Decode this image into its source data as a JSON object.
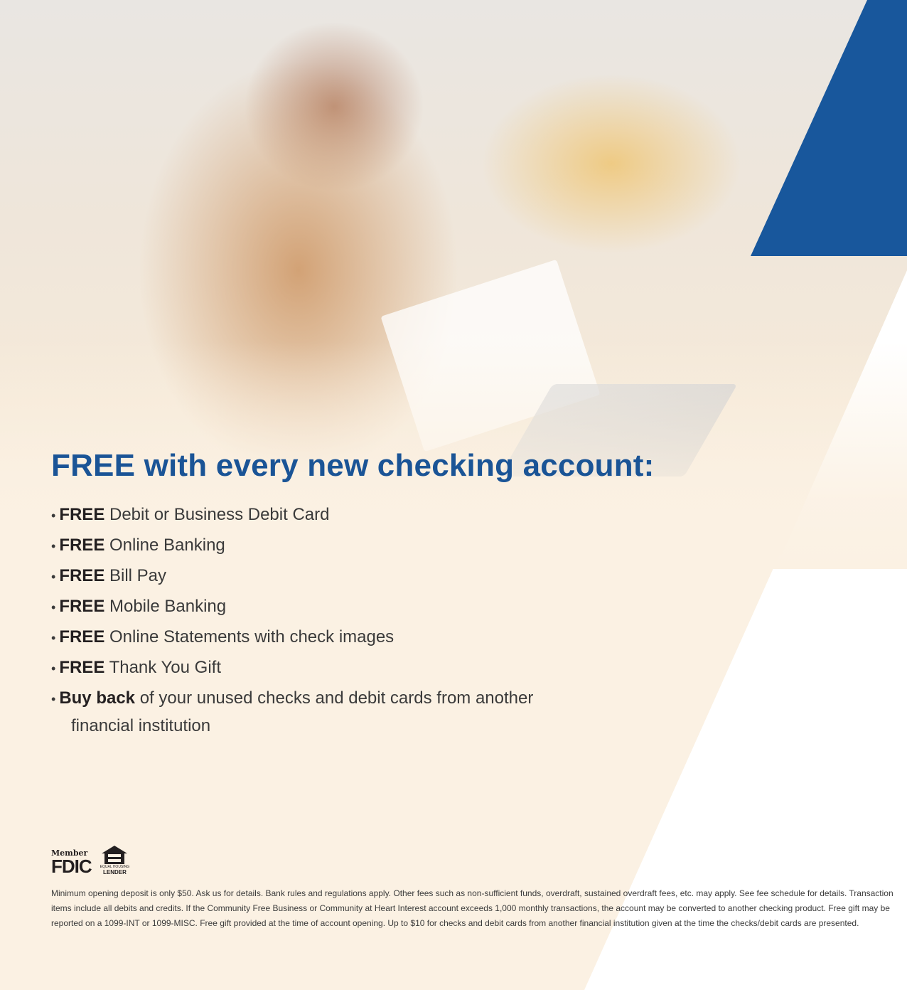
{
  "headline": "FREE with every new checking account:",
  "features": [
    {
      "bold": "FREE",
      "text": " Debit or Business Debit Card"
    },
    {
      "bold": "FREE",
      "text": " Online Banking"
    },
    {
      "bold": "FREE",
      "text": " Bill Pay"
    },
    {
      "bold": "FREE",
      "text": " Mobile Banking"
    },
    {
      "bold": "FREE",
      "text": " Online Statements with check images"
    },
    {
      "bold": "FREE",
      "text": " Thank You Gift"
    },
    {
      "bold": "Buy back",
      "text": " of your unused checks and debit cards from another",
      "text2": "financial institution"
    }
  ],
  "logos": {
    "fdic_member": "Member",
    "fdic_word": "FDIC",
    "ehl_small": "EQUAL HOUSING",
    "ehl_lender": "LENDER"
  },
  "disclaimer": "Minimum opening deposit is only $50. Ask us for details. Bank rules and regulations apply. Other fees such as non-sufficient funds, overdraft, sustained overdraft fees, etc. may apply. See fee schedule for details. Transaction items include all debits and credits. If the Community Free Business or Community at Heart Interest account exceeds 1,000 monthly transactions, the account may be converted to another checking product. Free gift may be reported on a 1099-INT or 1099-MISC. Free gift provided at the time of account opening. Up to $10 for checks and debit cards from another financial institution given at the time the checks/debit cards are presented.",
  "colors": {
    "brand_blue": "#1a5496",
    "accent_blue": "#18579c",
    "cream": "#fbf1e3"
  }
}
